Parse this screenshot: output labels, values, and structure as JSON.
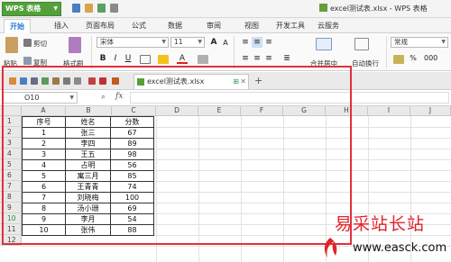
{
  "titlebar": {
    "app_button": "WPS 表格",
    "document_tab": "excel测试表.xlsx - WPS 表格"
  },
  "ribbon_tabs": [
    "开始",
    "插入",
    "页面布局",
    "公式",
    "数据",
    "审阅",
    "视图",
    "开发工具",
    "云服务"
  ],
  "ribbon": {
    "paste": "粘贴",
    "cut": "剪切",
    "copy": "复制",
    "format_painter": "格式刷",
    "font_name": "宋体",
    "font_size": "11",
    "merge_center": "合并居中",
    "auto_wrap": "自动换行",
    "number_format": "常规"
  },
  "docbar": {
    "file_tab": "excel测试表.xlsx",
    "add_tab": "+"
  },
  "formula_bar": {
    "name_box": "O10",
    "fx": "fx",
    "formula": ""
  },
  "columns": [
    "A",
    "B",
    "C",
    "D",
    "E",
    "F",
    "G",
    "H",
    "I",
    "J"
  ],
  "rows": [
    "1",
    "2",
    "3",
    "4",
    "5",
    "6",
    "7",
    "8",
    "9",
    "10",
    "11",
    "12"
  ],
  "selected_row": "10",
  "table": {
    "header": [
      "序号",
      "姓名",
      "分数"
    ],
    "rows": [
      [
        "1",
        "张三",
        "67"
      ],
      [
        "2",
        "李四",
        "89"
      ],
      [
        "3",
        "王五",
        "98"
      ],
      [
        "4",
        "占明",
        "56"
      ],
      [
        "5",
        "寓三月",
        "85"
      ],
      [
        "6",
        "王青青",
        "74"
      ],
      [
        "7",
        "刘晓梅",
        "100"
      ],
      [
        "8",
        "汤小珊",
        "69"
      ],
      [
        "9",
        "李月",
        "54"
      ],
      [
        "10",
        "张伟",
        "88"
      ]
    ]
  },
  "watermark": {
    "text": "易采站长站",
    "url": "www.easck.com"
  },
  "colors": {
    "wps_green": "#53a03c",
    "active_tab": "#2a7ad3",
    "highlight_frame": "#e0303a"
  }
}
